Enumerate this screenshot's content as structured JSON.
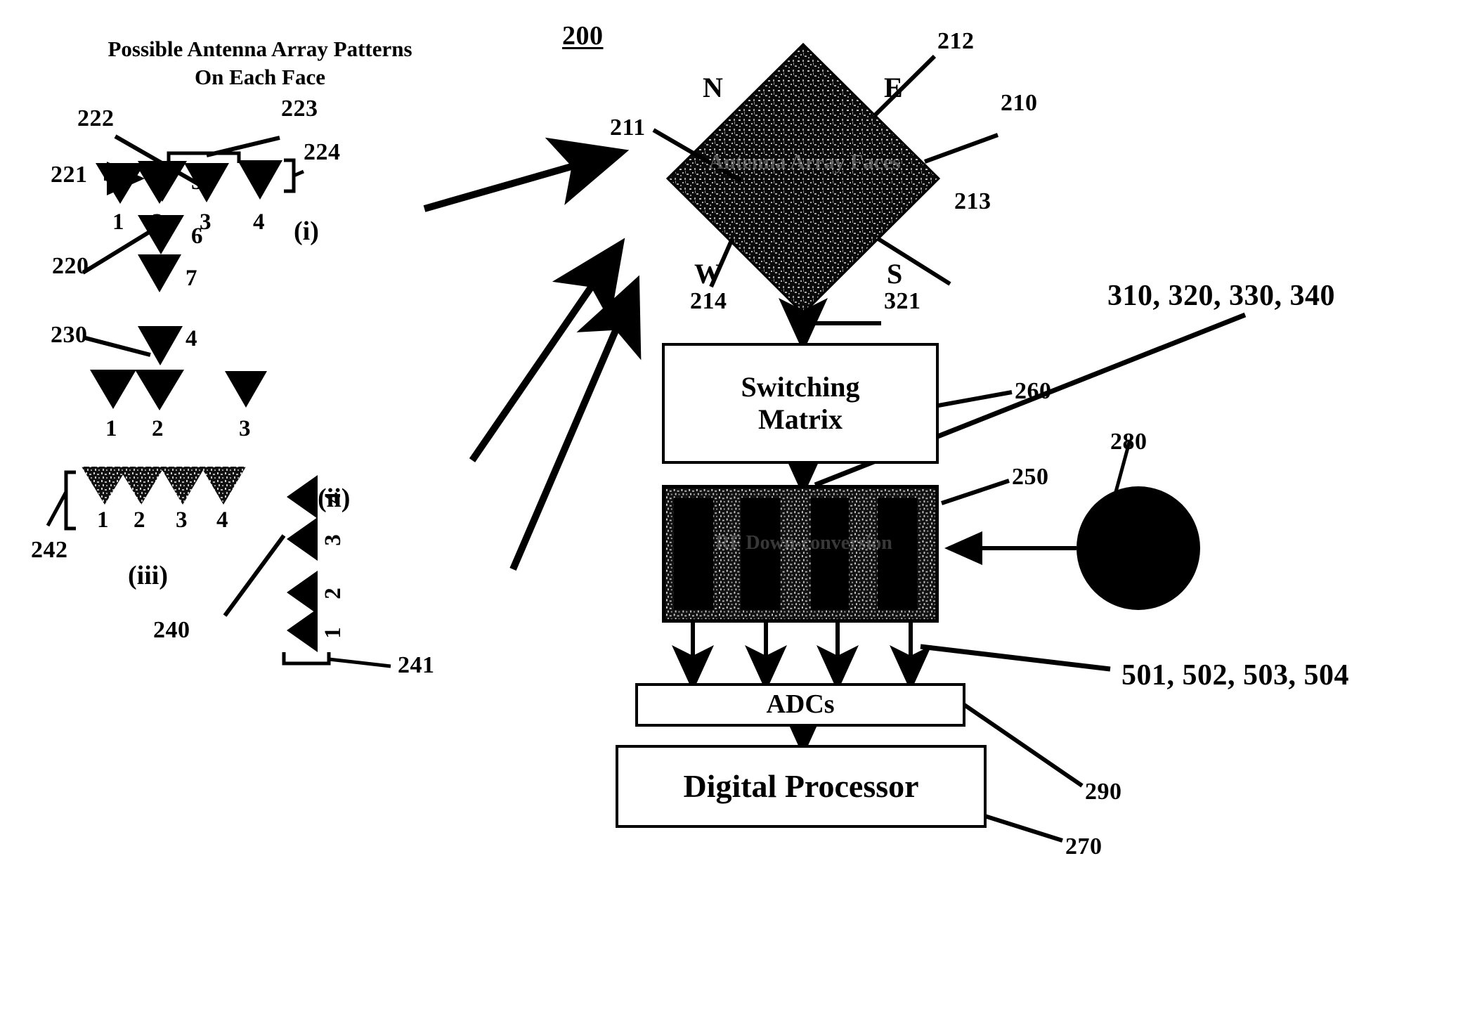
{
  "figure": {
    "number": "200",
    "left_title_line1": "Possible Antenna Array Patterns",
    "left_title_line2": "On Each Face"
  },
  "left_panel": {
    "group_222_223_224": {
      "ref_221": "221",
      "ref_222": "222",
      "ref_223": "223",
      "ref_224": "224",
      "ref_220": "220",
      "top_element_label": "5",
      "row_labels": [
        "1",
        "2",
        "3",
        "4"
      ],
      "lower_labels": [
        "6",
        "7"
      ]
    },
    "group_230": {
      "ref_230": "230",
      "top_element_label": "4",
      "row_labels": [
        "1",
        "2",
        "3"
      ]
    },
    "group_240": {
      "ref_240": "240",
      "ref_241": "241",
      "ref_242": "242",
      "roman": "(iii)",
      "horizontal_labels": [
        "1",
        "2",
        "3",
        "4"
      ],
      "vertical_labels": [
        "4",
        "3",
        "2",
        "1"
      ]
    },
    "roman_i": "(i)",
    "roman_ii": "(ii)"
  },
  "right_panel": {
    "array_faces": {
      "label": "Antenna Array Faces",
      "compass": {
        "n": "N",
        "e": "E",
        "w": "W",
        "s": "S"
      },
      "ref_210": "210",
      "ref_211": "211",
      "ref_212": "212",
      "ref_213": "213",
      "ref_214": "214",
      "ref_321": "321"
    },
    "switching_matrix": {
      "label_line1": "Switching",
      "label_line2": "Matrix",
      "ref": "260"
    },
    "downconverters": {
      "label": "RF Down-conversion",
      "ref": "250",
      "ref_channels": "310, 320, 330, 340",
      "channel_count": 4
    },
    "oscillator": {
      "ref": "280"
    },
    "adcs": {
      "label": "ADCs",
      "ref": "290",
      "ref_outputs": "501, 502, 503, 504"
    },
    "digital_processor": {
      "label": "Digital Processor",
      "ref": "270"
    }
  },
  "colors": {
    "ink": "#000000",
    "paper": "#ffffff"
  }
}
